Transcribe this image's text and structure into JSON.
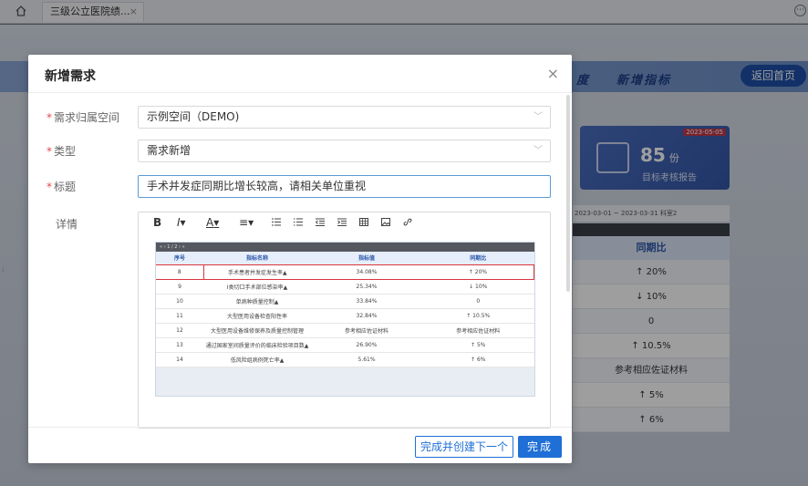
{
  "topbar": {
    "tab_label": "三级公立医院绩...",
    "tab_close": "×",
    "more_glyph": "⋯"
  },
  "background": {
    "nav_a": "度",
    "nav_b": "新增指标",
    "return_label": "返回首页",
    "card": {
      "date": "2023-05-05",
      "value": "85",
      "unit": "份",
      "subtitle": "目标考核报告"
    },
    "filter_text": "2023-03-01  ~  2023-03-31      科室2",
    "table_header": "同期比",
    "table_rows": [
      "↑ 20%",
      "↓ 10%",
      "0",
      "↑ 10.5%",
      "参考相应佐证材料",
      "↑ 5%",
      "↑ 6%"
    ]
  },
  "modal": {
    "title": "新增需求",
    "close_glyph": "×",
    "fields": {
      "space": {
        "label": "需求归属空间",
        "value": "示例空间（DEMO)"
      },
      "type": {
        "label": "类型",
        "value": "需求新增"
      },
      "title": {
        "label": "标题",
        "value": "手术并发症同期比增长较高，请相关单位重视"
      },
      "detail": {
        "label": "详情"
      }
    },
    "toolbar": {
      "bold": "B",
      "italic": "I",
      "font_color": "A",
      "align": "≡"
    },
    "embed": {
      "bar_text": "«  ‹  1  / 2  ›  »",
      "columns": [
        "序号",
        "指标名称",
        "指标值",
        "同期比"
      ],
      "rows": [
        [
          "8",
          "手术患者并发症发生率▲",
          "34.08%",
          "↑ 20%"
        ],
        [
          "9",
          "I类切口手术部位感染率▲",
          "25.34%",
          "↓ 10%"
        ],
        [
          "10",
          "单病种质量控制▲",
          "33.84%",
          "0"
        ],
        [
          "11",
          "大型医用设备检查阳性率",
          "32.84%",
          "↑ 10.5%"
        ],
        [
          "12",
          "大型医用设备维修保养及质量控制管理",
          "参考相应佐证材料",
          "参考相应佐证材料"
        ],
        [
          "13",
          "通过国家室间质量评价的临床检验项目数▲",
          "26.90%",
          "↑ 5%"
        ],
        [
          "14",
          "低风险组病例死亡率▲",
          "5.61%",
          "↑ 6%"
        ]
      ]
    },
    "buttons": {
      "create_next": "完成并创建下一个",
      "done": "完成"
    },
    "colors": {
      "primary": "#1f6fd6",
      "required": "#e04a4a",
      "highlight": "#d9363e"
    }
  }
}
